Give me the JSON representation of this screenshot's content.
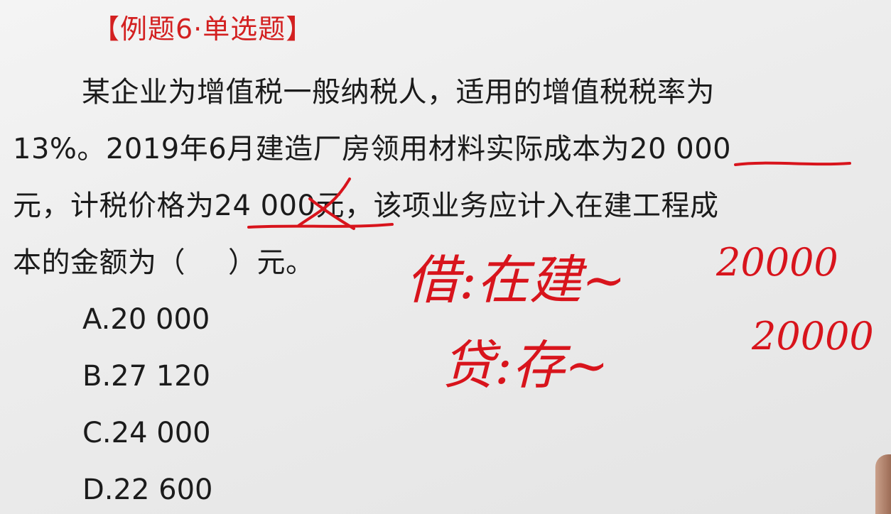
{
  "question": {
    "title": "【例题6·单选题】",
    "stem_line1": "某企业为增值税一般纳税人，适用的增值税税率为",
    "stem_line2": "13%。2019年6月建造厂房领用材料实际成本为20 000",
    "stem_line3": "元，计税价格为24 000元，该项业务应计入在建工程成",
    "stem_line4_before": "本的金额为（",
    "stem_line4_after": "）元。",
    "options": [
      {
        "label": "A.20 000"
      },
      {
        "label": "B.27 120"
      },
      {
        "label": "C.24 000"
      },
      {
        "label": "D.22 600"
      }
    ]
  },
  "annotations": {
    "debit_text": "借:在建~",
    "debit_amount": "20000",
    "credit_text": "贷:存~",
    "credit_amount": "20000",
    "ink_color": "#d8141c"
  },
  "colors": {
    "title_red": "#d32020",
    "text": "#1b1b1b",
    "background": "#ececec"
  }
}
